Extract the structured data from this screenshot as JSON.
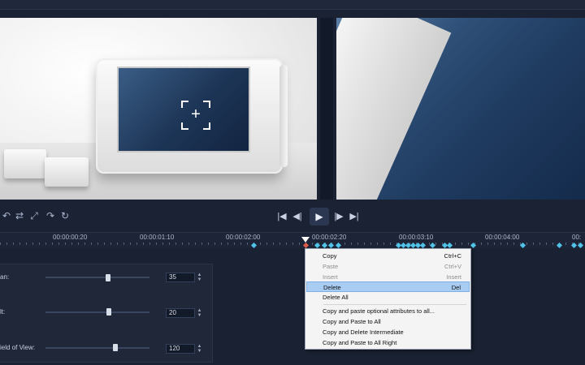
{
  "timeline": {
    "ticks": [
      "00:00:00:20",
      "00:00:01:10",
      "00:00:02:00",
      "00:00:02:20",
      "00:00:03:10",
      "00:00:04:00",
      "00:"
    ]
  },
  "params": [
    {
      "label": "an:",
      "value": "35",
      "level": 0.6
    },
    {
      "label": "lt:",
      "value": "20",
      "level": 0.61
    },
    {
      "label": "ield of View:",
      "value": "120",
      "level": 0.67
    }
  ],
  "context_menu": {
    "copy": {
      "label": "Copy",
      "shortcut": "Ctrl+C"
    },
    "paste": {
      "label": "Paste",
      "shortcut": "Ctrl+V"
    },
    "insert": {
      "label": "Insert",
      "shortcut": "Insert"
    },
    "delete": {
      "label": "Delete",
      "shortcut": "Del"
    },
    "delete_all": {
      "label": "Delete All"
    },
    "copy_paste_optional": {
      "label": "Copy and paste optional attributes to all..."
    },
    "copy_paste_all": {
      "label": "Copy and Paste to All"
    },
    "copy_delete_intermediate": {
      "label": "Copy and Delete Intermediate"
    },
    "copy_paste_all_right": {
      "label": "Copy and Paste to All Right"
    }
  },
  "icons": {
    "tools": [
      "rotate-left-icon",
      "swap-icon",
      "flip-icon",
      "rotate-right-icon",
      "reset-icon"
    ],
    "playback": [
      "go-to-start-icon",
      "previous-frame-icon",
      "play-icon",
      "next-frame-icon",
      "go-to-end-icon"
    ]
  }
}
